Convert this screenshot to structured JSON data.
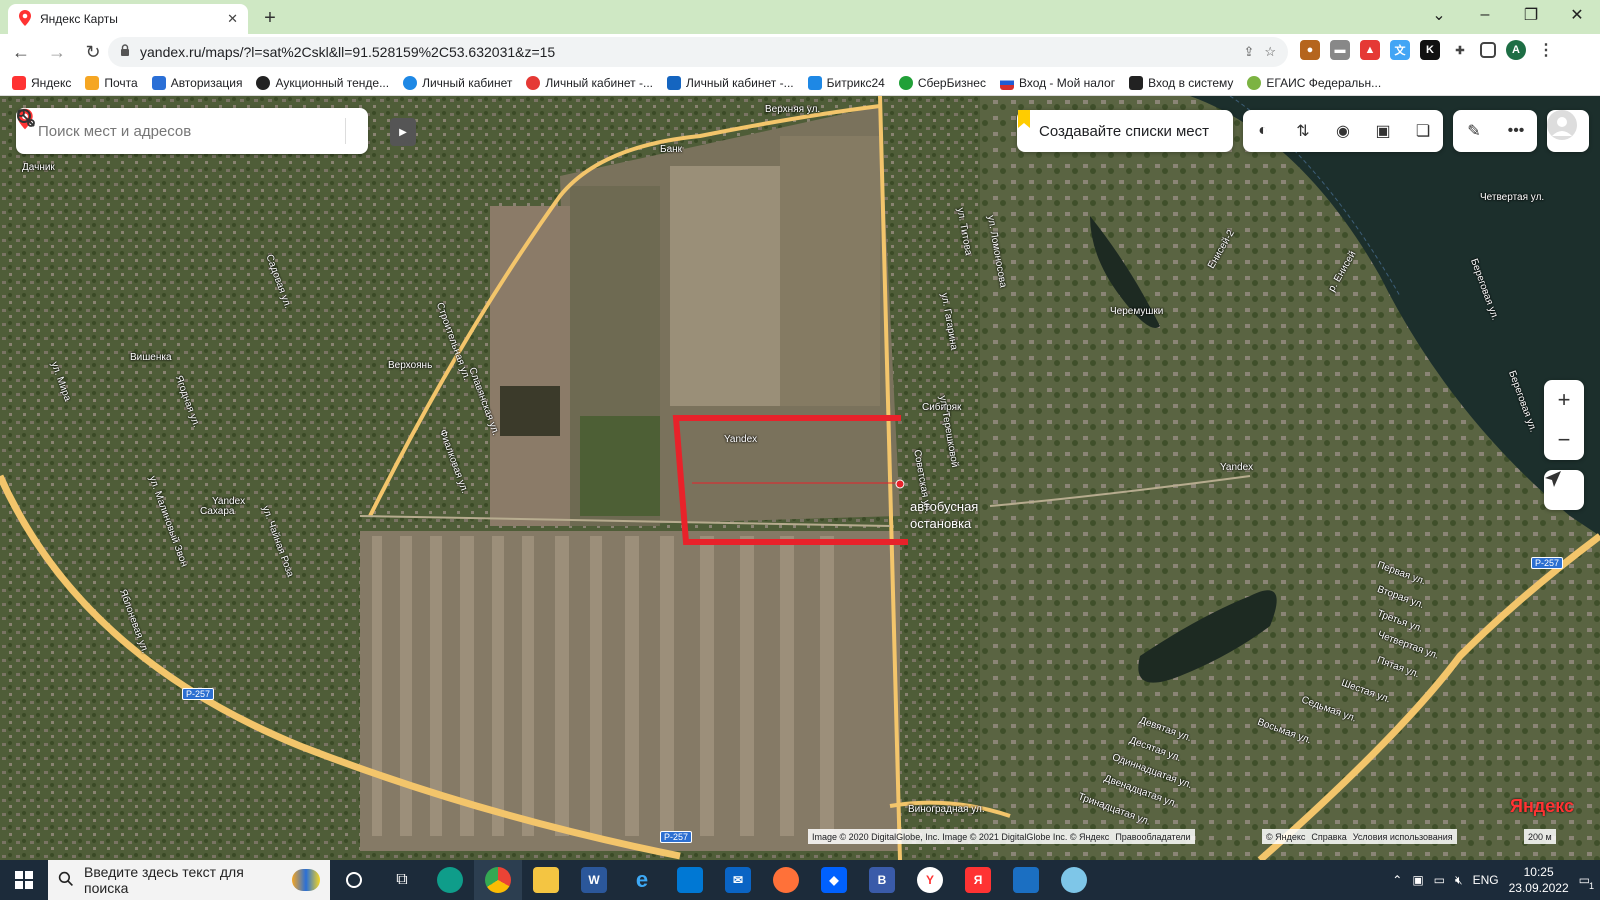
{
  "browser": {
    "tab_title": "Яндекс Карты",
    "url": "yandex.ru/maps/?l=sat%2Cskl&ll=91.528159%2C53.632031&z=15",
    "profile_letter": "A",
    "window_controls": [
      "⌄",
      "–",
      "❐",
      "✕"
    ]
  },
  "bookmarks": [
    {
      "label": "Яндекс",
      "color": "#f33"
    },
    {
      "label": "Почта",
      "color": "#f5a623"
    },
    {
      "label": "Авторизация",
      "color": "#2a6fd6"
    },
    {
      "label": "Аукционный тенде...",
      "color": "#222"
    },
    {
      "label": "Личный кабинет",
      "color": "#1e88e5"
    },
    {
      "label": "Личный кабинет -...",
      "color": "#e53935"
    },
    {
      "label": "Личный кабинет -...",
      "color": "#1565c0"
    },
    {
      "label": "Битрикс24",
      "color": "#1e88e5"
    },
    {
      "label": "СберБизнес",
      "color": "#21a038"
    },
    {
      "label": "Вход - Мой налог",
      "color": "#d32f2f"
    },
    {
      "label": "Вход в систему",
      "color": "#222"
    },
    {
      "label": "ЕГАИС Федеральн...",
      "color": "#7cb342"
    }
  ],
  "map": {
    "search_placeholder": "Поиск мест и адресов",
    "lists_button": "Создавайте списки мест",
    "annotation": [
      "автобусная",
      "остановка"
    ],
    "zoom_in": "+",
    "zoom_out": "−",
    "copyright_left": [
      "Image © 2020 DigitalGlobe, Inc. Image © 2021 DigitalGlobe Inc. © Яндекс",
      "Правообладатели"
    ],
    "copyright_right": [
      "© Яндекс",
      "Справка",
      "Условия использования"
    ],
    "scale": "200 м",
    "logo": "Яндекс",
    "road_badges": [
      "Р-257",
      "Р-257",
      "Р-257"
    ],
    "labels": [
      "Верхняя ул.",
      "Банк",
      "Дачник",
      "Вишенка",
      "Верхоянь",
      "Сахара",
      "Сибиряк",
      "Черемушки",
      "Енисей-2",
      "р. Енисей",
      "ул. Титова",
      "Советская ул.",
      "ул. Гагарина",
      "ул. Терешковой",
      "ул. Ломоносова",
      "Береговая ул.",
      "Первая ул.",
      "Вторая ул.",
      "Третья ул.",
      "Четвертая ул.",
      "Пятая ул.",
      "Шестая ул.",
      "Седьмая ул.",
      "Восьмая ул.",
      "Девятая ул.",
      "Десятая ул.",
      "Одиннадцатая ул.",
      "Двенадцатая ул.",
      "Тринадцатая ул.",
      "Виноградная ул.",
      "Yandex",
      "Yandex",
      "Yandex",
      "Четвертая ул.",
      "Береговая ул.",
      "ул. Мира",
      "Ягодная ул.",
      "ул. Малиновый Звон",
      "ул. Чайная Роза",
      "Яблоневая ул.",
      "Строительная ул.",
      "Славянская ул.",
      "Фиалковая ул.",
      "Садовая ул."
    ]
  },
  "taskbar": {
    "search_placeholder": "Введите здесь текст для поиска",
    "lang": "ENG",
    "time": "10:25",
    "date": "23.09.2022",
    "notif_count": "1"
  },
  "colors": {
    "selection": "#e8222a",
    "road": "#f3c56b",
    "tab_strip": "#cfe8c4"
  }
}
